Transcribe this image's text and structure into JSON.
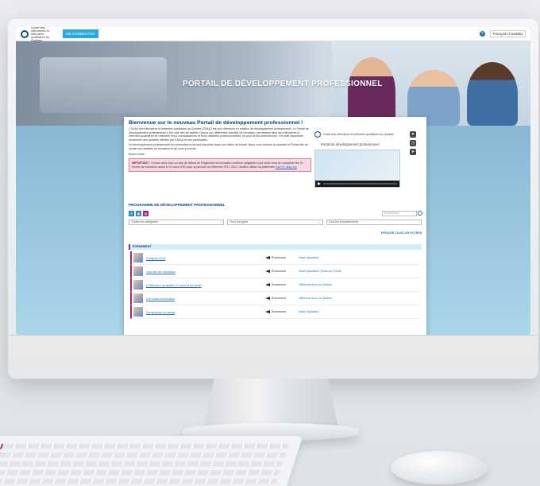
{
  "header": {
    "logo_text": "Ordre des infirmières et infirmiers auxiliaires du Québec",
    "connect_label": "ME CONNECTER",
    "language": "Français (Canada)"
  },
  "hero": {
    "title": "PORTAIL DE DÉVELOPPEMENT PROFESSIONNEL"
  },
  "welcome": {
    "heading": "Bienvenue sur le nouveau Portail de développement professionnel !",
    "p1": "L'Ordre des infirmières et infirmiers auxiliaires du Québec (OIIAQ) est une référence en matière de développement professionnel. Le Portail de développement professionnel a été créé afin de faciliter l'accès aux différentes activités de formation, permettant ainsi aux infirmières et infirmiers auxiliaires de maintenir leurs connaissances et leurs habiletés professionnelles, en plus de les perfectionner. Cet outil rassemble l'ensemble des activités offertes par l'OIIAQ et ses partenaires.",
    "p2": "Le développement professionnel est primordial et permet d'accéder dans son milieu de travail. Nous vous invitons à consulter le Portail afin de choisir vos activités de formation et de vous y inscrire.",
    "sign": "Bonne visite !",
    "important_label": "IMPORTANT :",
    "important_text": "Si vous avez reçu un avis de défaut du Règlement de formation continue obligatoire pour avoir omis de compléter les 10 heures de formation avant le 31 mars 2019 pour la période de référence 2017-2019, veuillez utiliser la plateforme",
    "important_link": "SamYA oiiaq.org"
  },
  "sidebar_card": {
    "logo_text": "Ordre des infirmières et infirmiers auxiliaires du Québec",
    "caption": "Portail de développement professionnel"
  },
  "program": {
    "title": "PROGRAMME DE DÉVELOPPEMENT PROFESSIONNEL",
    "search_placeholder": "Rechercher",
    "filters": [
      "Toutes les catégories",
      "Tous les types",
      "Tous les emplacements"
    ],
    "clear_label": "EFFACER TOUS LES FILTRES",
    "group_label": "ÉVÉNEMENT",
    "rows": [
      {
        "title": "Congrès 2019",
        "kind": "Événement",
        "location": "Saint-Hyacinthe"
      },
      {
        "title": "Journée de formation",
        "kind": "Événement",
        "location": "Saint-Hyacinthe Centre-de-Pointe"
      },
      {
        "title": "L'infirmière auxiliaire en soins à domicile",
        "kind": "Événement",
        "location": "Différents lieux au Québec"
      },
      {
        "title": "Les voies d'évolution",
        "kind": "Événement",
        "location": "Différents lieux au Québec"
      },
      {
        "title": "Symposium en santé",
        "kind": "Événement",
        "location": "Saint-Hyacinthe"
      }
    ]
  }
}
